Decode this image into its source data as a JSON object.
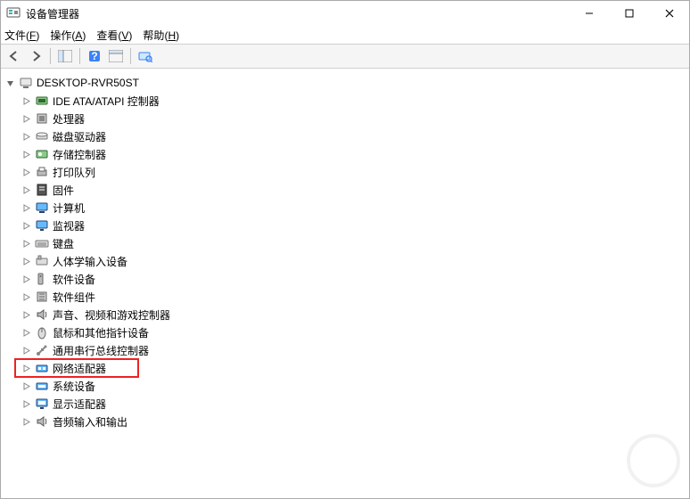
{
  "window": {
    "title": "设备管理器",
    "controls": {
      "min": "–",
      "max": "☐",
      "close": "✕"
    }
  },
  "menu": {
    "file": {
      "label": "文件",
      "hotkey": "F"
    },
    "action": {
      "label": "操作",
      "hotkey": "A"
    },
    "view": {
      "label": "查看",
      "hotkey": "V"
    },
    "help": {
      "label": "帮助",
      "hotkey": "H"
    }
  },
  "toolbar": {
    "back": "后退",
    "forward": "前进",
    "show_hide": "显示/隐藏控制台树",
    "help": "帮助",
    "properties": "属性",
    "scan": "扫描检测硬件改动"
  },
  "tree": {
    "root": {
      "label": "DESKTOP-RVR50ST",
      "expanded": true
    },
    "children": [
      {
        "id": "ide",
        "label": "IDE ATA/ATAPI 控制器",
        "icon": "ide"
      },
      {
        "id": "processor",
        "label": "处理器",
        "icon": "chip"
      },
      {
        "id": "disk",
        "label": "磁盘驱动器",
        "icon": "disk"
      },
      {
        "id": "storage",
        "label": "存储控制器",
        "icon": "storage"
      },
      {
        "id": "printqueue",
        "label": "打印队列",
        "icon": "printer"
      },
      {
        "id": "firmware",
        "label": "固件",
        "icon": "firmware"
      },
      {
        "id": "computer",
        "label": "计算机",
        "icon": "computer"
      },
      {
        "id": "monitor",
        "label": "监视器",
        "icon": "monitor"
      },
      {
        "id": "keyboard",
        "label": "键盘",
        "icon": "keyboard"
      },
      {
        "id": "hid",
        "label": "人体学输入设备",
        "icon": "hid"
      },
      {
        "id": "swdevice",
        "label": "软件设备",
        "icon": "swdev"
      },
      {
        "id": "swcomponent",
        "label": "软件组件",
        "icon": "swcomp"
      },
      {
        "id": "sound",
        "label": "声音、视频和游戏控制器",
        "icon": "sound"
      },
      {
        "id": "mouse",
        "label": "鼠标和其他指针设备",
        "icon": "mouse"
      },
      {
        "id": "usb",
        "label": "通用串行总线控制器",
        "icon": "usb"
      },
      {
        "id": "network",
        "label": "网络适配器",
        "icon": "network",
        "highlighted": true
      },
      {
        "id": "system",
        "label": "系统设备",
        "icon": "system"
      },
      {
        "id": "display",
        "label": "显示适配器",
        "icon": "display"
      },
      {
        "id": "audioio",
        "label": "音频输入和输出",
        "icon": "sound"
      }
    ]
  },
  "watermark": {
    "text": ""
  }
}
